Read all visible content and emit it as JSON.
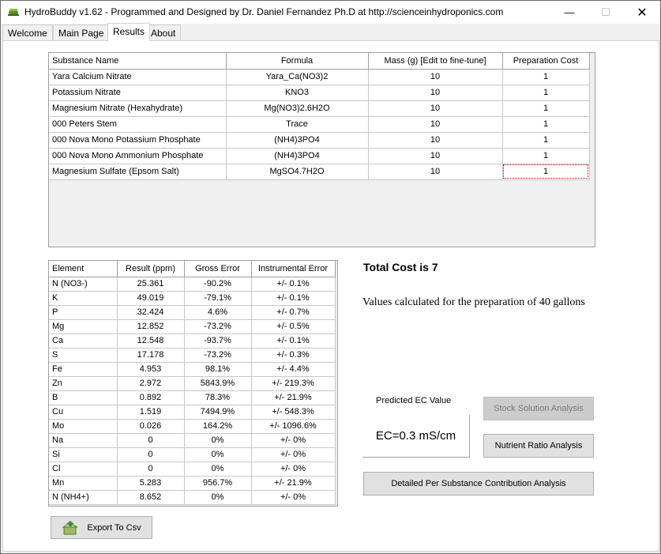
{
  "window": {
    "title": "HydroBuddy v1.62 - Programmed and Designed by Dr. Daniel Fernandez Ph.D at http://scienceinhydroponics.com",
    "minimize_glyph": "—",
    "maximize_glyph": "☐",
    "close_glyph": "✕"
  },
  "tabs": [
    {
      "label": "Welcome"
    },
    {
      "label": "Main Page"
    },
    {
      "label": "Results"
    },
    {
      "label": "About"
    }
  ],
  "substances": {
    "headers": [
      "Substance Name",
      "Formula",
      "Mass (g) [Edit to fine-tune]",
      "Preparation Cost"
    ],
    "rows": [
      {
        "name": "Yara Calcium Nitrate",
        "formula": "Yara_Ca(NO3)2",
        "mass": "10",
        "cost": "1"
      },
      {
        "name": "Potassium Nitrate",
        "formula": "KNO3",
        "mass": "10",
        "cost": "1"
      },
      {
        "name": "Magnesium Nitrate (Hexahydrate)",
        "formula": "Mg(NO3)2.6H2O",
        "mass": "10",
        "cost": "1"
      },
      {
        "name": "000 Peters Stem",
        "formula": "Trace",
        "mass": "10",
        "cost": "1"
      },
      {
        "name": "000 Nova Mono Potassium Phosphate",
        "formula": "(NH4)3PO4",
        "mass": "10",
        "cost": "1"
      },
      {
        "name": "000 Nova Mono Ammonium Phosphate",
        "formula": "(NH4)3PO4",
        "mass": "10",
        "cost": "1"
      },
      {
        "name": "Magnesium Sulfate (Epsom Salt)",
        "formula": "MgSO4.7H2O",
        "mass": "10",
        "cost": "1"
      }
    ]
  },
  "elements": {
    "headers": [
      "Element",
      "Result (ppm)",
      "Gross Error",
      "Instrumental Error"
    ],
    "rows": [
      {
        "element": "N (NO3-)",
        "result": "25.361",
        "gross": "-90.2%",
        "instr": "+/- 0.1%"
      },
      {
        "element": "K",
        "result": "49.019",
        "gross": "-79.1%",
        "instr": "+/- 0.1%"
      },
      {
        "element": "P",
        "result": "32.424",
        "gross": "4.6%",
        "instr": "+/- 0.7%"
      },
      {
        "element": "Mg",
        "result": "12.852",
        "gross": "-73.2%",
        "instr": "+/- 0.5%"
      },
      {
        "element": "Ca",
        "result": "12.548",
        "gross": "-93.7%",
        "instr": "+/- 0.1%"
      },
      {
        "element": "S",
        "result": "17.178",
        "gross": "-73.2%",
        "instr": "+/- 0.3%"
      },
      {
        "element": "Fe",
        "result": "4.953",
        "gross": "98.1%",
        "instr": "+/- 4.4%"
      },
      {
        "element": "Zn",
        "result": "2.972",
        "gross": "5843.9%",
        "instr": "+/- 219.3%"
      },
      {
        "element": "B",
        "result": "0.892",
        "gross": "78.3%",
        "instr": "+/- 21.9%"
      },
      {
        "element": "Cu",
        "result": "1.519",
        "gross": "7494.9%",
        "instr": "+/- 548.3%"
      },
      {
        "element": "Mo",
        "result": "0.026",
        "gross": "164.2%",
        "instr": "+/- 1096.6%"
      },
      {
        "element": "Na",
        "result": "0",
        "gross": "0%",
        "instr": "+/- 0%"
      },
      {
        "element": "Si",
        "result": "0",
        "gross": "0%",
        "instr": "+/- 0%"
      },
      {
        "element": "Cl",
        "result": "0",
        "gross": "0%",
        "instr": "+/- 0%"
      },
      {
        "element": "Mn",
        "result": "5.283",
        "gross": "956.7%",
        "instr": "+/- 21.9%"
      },
      {
        "element": "N (NH4+)",
        "result": "8.652",
        "gross": "0%",
        "instr": "+/- 0%"
      }
    ]
  },
  "summary": {
    "total_cost": "Total Cost is 7",
    "values_note": "Values calculated for the preparation of 40 gallons"
  },
  "ec": {
    "label": "Predicted EC Value",
    "value": "EC=0.3 mS/cm"
  },
  "buttons": {
    "stock": "Stock Solution Analysis",
    "ratio": "Nutrient Ratio Analysis",
    "detailed": "Detailed Per Substance Contribution Analysis",
    "export": "Export To Csv"
  }
}
